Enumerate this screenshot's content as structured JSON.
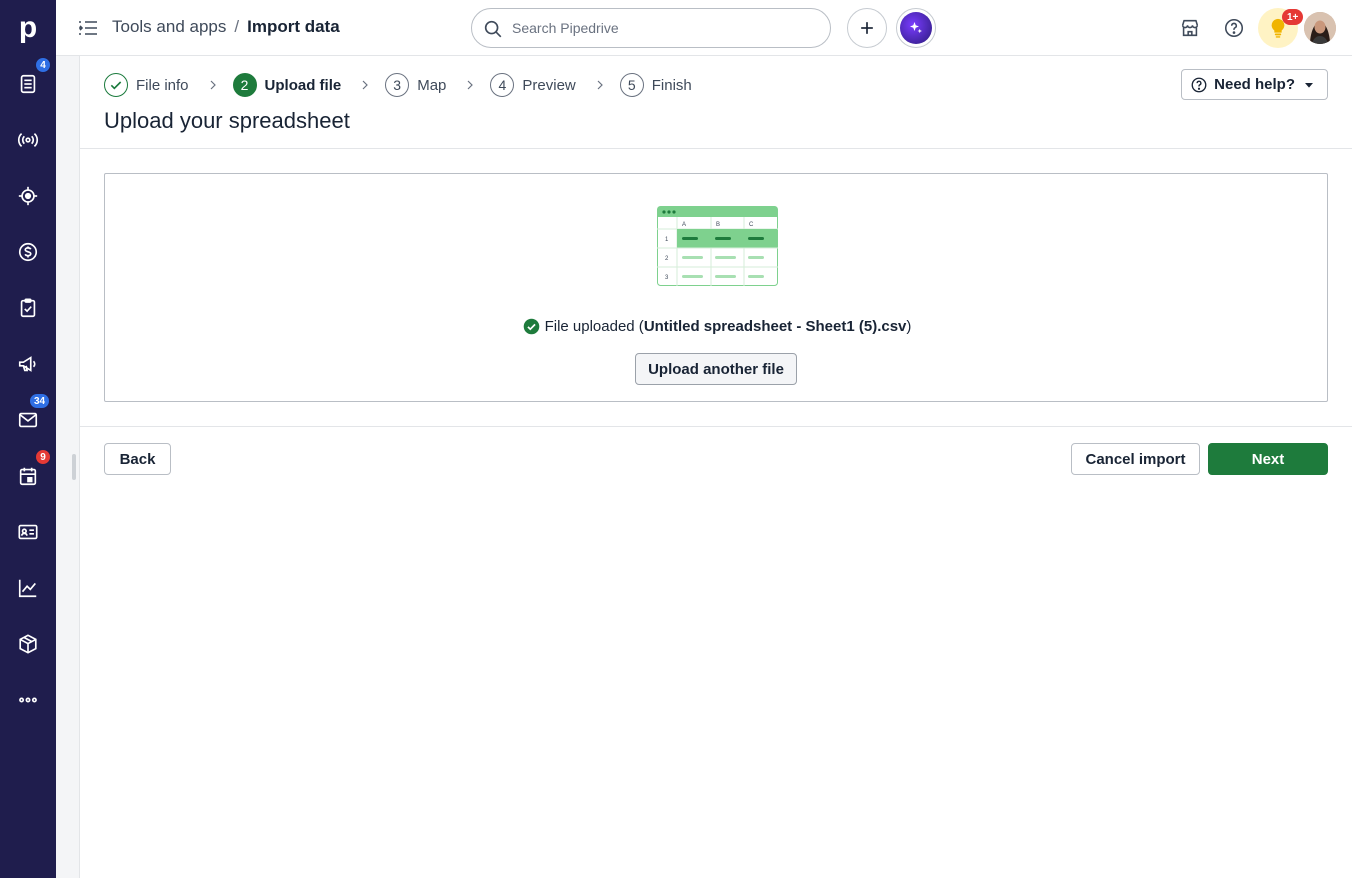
{
  "sidebar": {
    "logo": "p",
    "items": [
      {
        "icon": "leads-inbox-icon",
        "badge": "4",
        "badge_color": "blue"
      },
      {
        "icon": "broadcast-icon"
      },
      {
        "icon": "target-icon"
      },
      {
        "icon": "dollar-icon"
      },
      {
        "icon": "clipboard-check-icon"
      },
      {
        "icon": "megaphone-icon"
      },
      {
        "icon": "mail-icon",
        "badge": "34",
        "badge_color": "blue"
      },
      {
        "icon": "calendar-icon",
        "badge": "9",
        "badge_color": "red"
      },
      {
        "icon": "contacts-card-icon"
      },
      {
        "icon": "chart-line-icon"
      },
      {
        "icon": "box-icon"
      },
      {
        "icon": "more-icon"
      }
    ]
  },
  "topbar": {
    "breadcrumb_parent": "Tools and apps",
    "breadcrumb_separator": "/",
    "breadcrumb_current": "Import data",
    "search_placeholder": "Search Pipedrive",
    "notification_badge": "1+"
  },
  "wizard": {
    "steps": [
      {
        "number": "1",
        "label": "File info",
        "state": "done"
      },
      {
        "number": "2",
        "label": "Upload file",
        "state": "active"
      },
      {
        "number": "3",
        "label": "Map",
        "state": "pending"
      },
      {
        "number": "4",
        "label": "Preview",
        "state": "pending"
      },
      {
        "number": "5",
        "label": "Finish",
        "state": "pending"
      }
    ],
    "help_label": "Need help?",
    "page_title": "Upload your spreadsheet"
  },
  "upload": {
    "illustration": {
      "columns": [
        "A",
        "B",
        "C"
      ],
      "rows": [
        "1",
        "2",
        "3"
      ]
    },
    "status_prefix": "File uploaded (",
    "file_name": "Untitled spreadsheet - Sheet1 (5).csv",
    "status_suffix": ")",
    "upload_another_label": "Upload another file"
  },
  "footer": {
    "back_label": "Back",
    "cancel_label": "Cancel import",
    "next_label": "Next"
  },
  "colors": {
    "sidebar_bg": "#1f1d4d",
    "primary_green": "#1e7b3c",
    "badge_blue": "#2f6fe4",
    "badge_red": "#e53935"
  }
}
